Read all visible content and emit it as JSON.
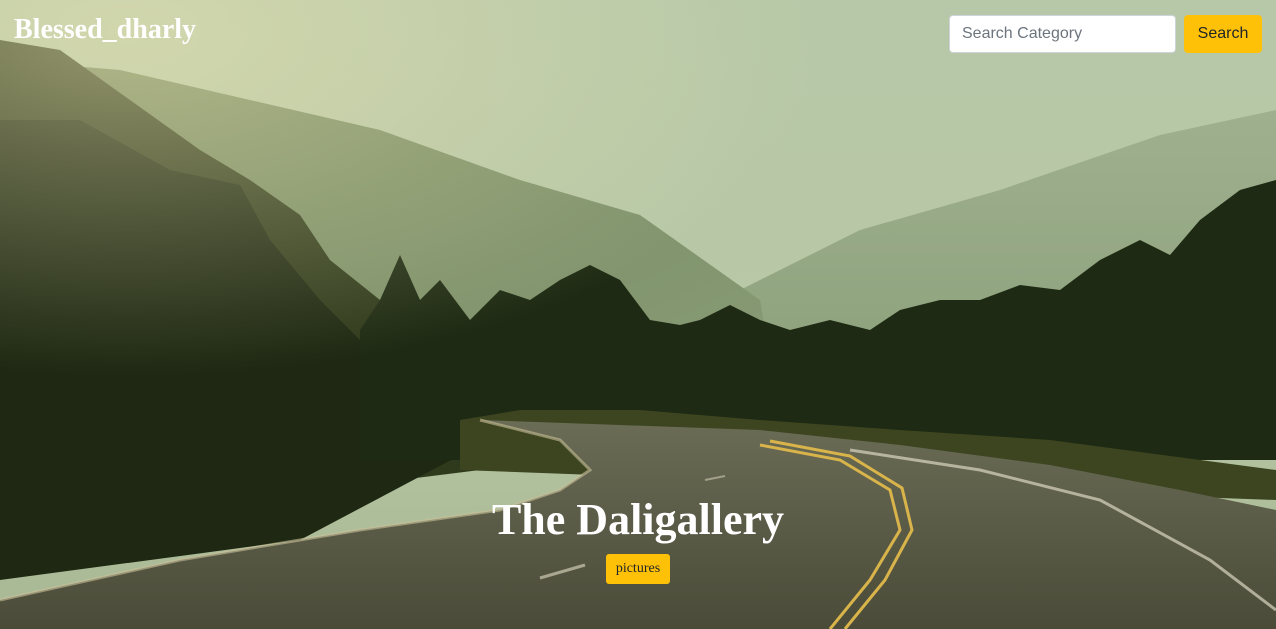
{
  "header": {
    "brand": "Blessed_dharly",
    "search": {
      "placeholder": "Search Category",
      "value": "",
      "button_label": "Search"
    }
  },
  "hero": {
    "title": "The Daligallery",
    "tag_label": "pictures"
  },
  "colors": {
    "accent": "#ffc107",
    "heading_text": "#ffffff"
  }
}
